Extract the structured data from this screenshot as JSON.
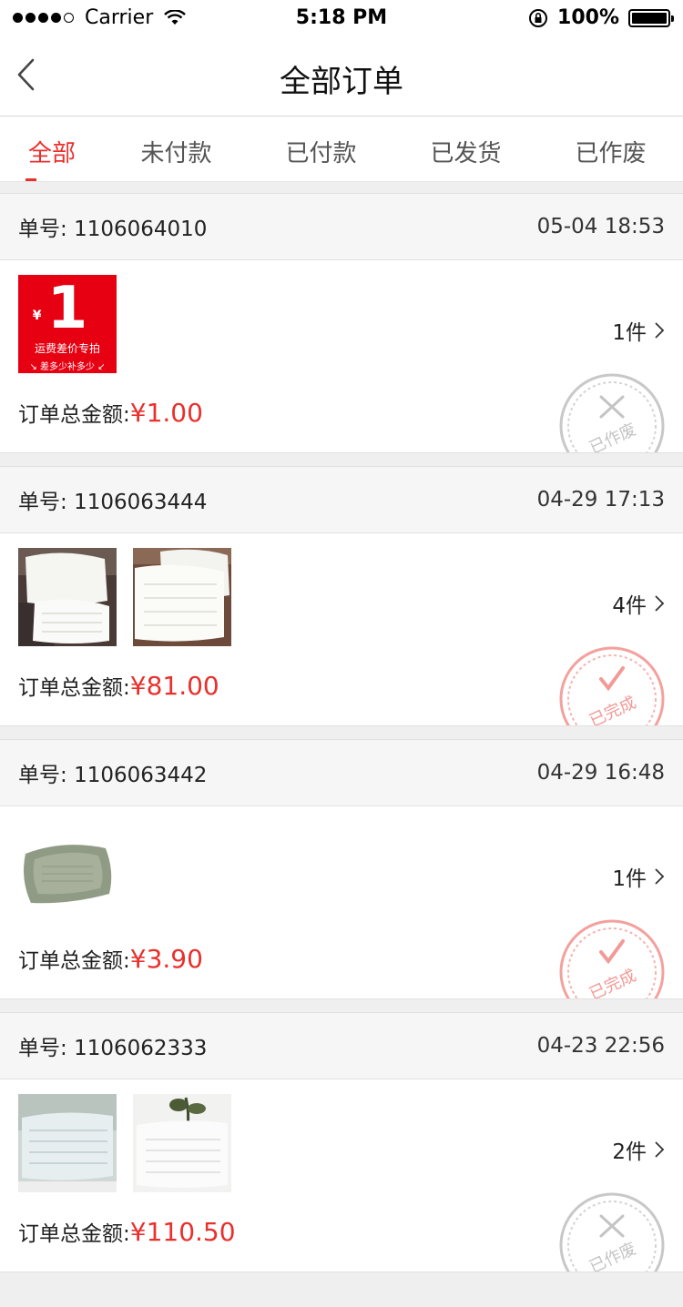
{
  "status_bar": {
    "carrier": "Carrier",
    "time": "5:18 PM",
    "battery": "100%",
    "signal_bars": 5,
    "signal_filled": 4
  },
  "nav": {
    "title": "全部订单"
  },
  "tabs": [
    {
      "label": "全部",
      "active": true
    },
    {
      "label": "未付款",
      "active": false
    },
    {
      "label": "已付款",
      "active": false
    },
    {
      "label": "已发货",
      "active": false
    },
    {
      "label": "已作废",
      "active": false
    }
  ],
  "orders": [
    {
      "number_label": "单号:",
      "number": "1106064010",
      "time": "05-04 18:53",
      "qty": "1件",
      "total_label": "订单总金额:",
      "total": "¥1.00",
      "stamp": "已作废",
      "stamp_color": "#bdbdbd",
      "promo": {
        "yen": "¥",
        "num": "1",
        "line1": "运费差价专拍",
        "line2": "↘ 差多少补多少 ↙"
      }
    },
    {
      "number_label": "单号:",
      "number": "1106063444",
      "time": "04-29 17:13",
      "qty": "4件",
      "total_label": "订单总金额:",
      "total": "¥81.00",
      "stamp": "已完成",
      "stamp_color": "#f29a96"
    },
    {
      "number_label": "单号:",
      "number": "1106063442",
      "time": "04-29 16:48",
      "qty": "1件",
      "total_label": "订单总金额:",
      "total": "¥3.90",
      "stamp": "已完成",
      "stamp_color": "#f29a96"
    },
    {
      "number_label": "单号:",
      "number": "1106062333",
      "time": "04-23 22:56",
      "qty": "2件",
      "total_label": "订单总金额:",
      "total": "¥110.50",
      "stamp": "已作废",
      "stamp_color": "#bdbdbd"
    }
  ],
  "colors": {
    "accent": "#e9302d",
    "background": "#efefef",
    "header_bg": "#f6f6f6"
  }
}
